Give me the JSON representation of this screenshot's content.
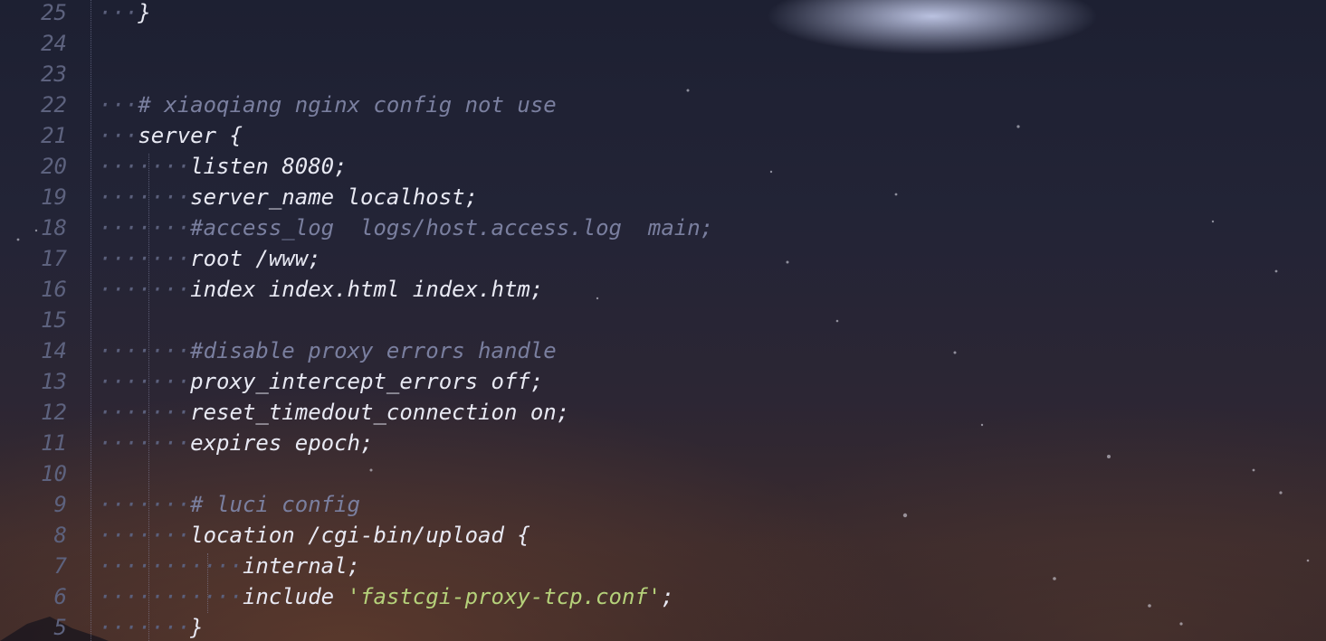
{
  "editor": {
    "lines": [
      {
        "number": "25",
        "ws": "···",
        "code": "}",
        "kind": "code"
      },
      {
        "number": "24",
        "ws": "",
        "code": "",
        "kind": "code"
      },
      {
        "number": "23",
        "ws": "",
        "code": "",
        "kind": "code"
      },
      {
        "number": "22",
        "ws": "···",
        "code": "# xiaoqiang nginx config not use",
        "kind": "comment"
      },
      {
        "number": "21",
        "ws": "···",
        "code": "server {",
        "kind": "code"
      },
      {
        "number": "20",
        "ws": "·······",
        "code": "listen 8080;",
        "kind": "code"
      },
      {
        "number": "19",
        "ws": "·······",
        "code": "server_name localhost;",
        "kind": "code"
      },
      {
        "number": "18",
        "ws": "·······",
        "code": "#access_log  logs/host.access.log  main;",
        "kind": "comment"
      },
      {
        "number": "17",
        "ws": "·······",
        "code": "root /www;",
        "kind": "code"
      },
      {
        "number": "16",
        "ws": "·······",
        "code": "index index.html index.htm;",
        "kind": "code"
      },
      {
        "number": "15",
        "ws": "",
        "code": "",
        "kind": "code"
      },
      {
        "number": "14",
        "ws": "·······",
        "code": "#disable proxy errors handle",
        "kind": "comment"
      },
      {
        "number": "13",
        "ws": "·······",
        "code": "proxy_intercept_errors off;",
        "kind": "code"
      },
      {
        "number": "12",
        "ws": "·······",
        "code": "reset_timedout_connection on;",
        "kind": "code"
      },
      {
        "number": "11",
        "ws": "·······",
        "code": "expires epoch;",
        "kind": "code"
      },
      {
        "number": "10",
        "ws": "",
        "code": "",
        "kind": "code"
      },
      {
        "number": "9",
        "ws": "·······",
        "code": "# luci config",
        "kind": "comment"
      },
      {
        "number": "8",
        "ws": "·······",
        "code": "location /cgi-bin/upload {",
        "kind": "code"
      },
      {
        "number": "7",
        "ws": "···········",
        "code": "internal;",
        "kind": "code"
      },
      {
        "number": "6",
        "ws": "···········",
        "code": "include ",
        "string": "'fastcgi-proxy-tcp.conf'",
        "tail": ";",
        "kind": "include"
      },
      {
        "number": "5",
        "ws": "·······",
        "code": "}",
        "kind": "code"
      }
    ]
  }
}
